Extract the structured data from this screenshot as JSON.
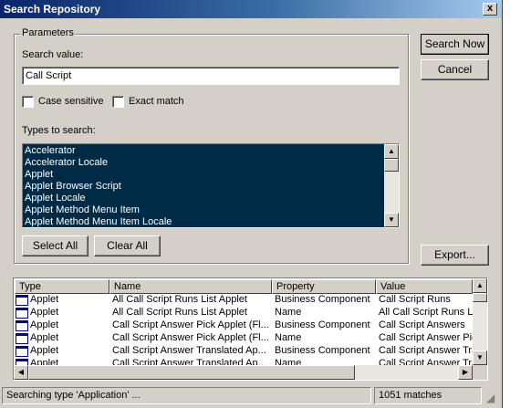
{
  "window": {
    "title": "Search Repository",
    "close_glyph": "x"
  },
  "buttons": {
    "search_now": "Search Now",
    "cancel": "Cancel",
    "export": "Export...",
    "select_all": "Select All",
    "clear_all": "Clear All"
  },
  "parameters": {
    "group_label": "Parameters",
    "search_value_label": "Search value:",
    "search_value": "Call Script",
    "case_sensitive_label": "Case sensitive",
    "case_sensitive_checked": false,
    "exact_match_label": "Exact match",
    "exact_match_checked": false,
    "types_label": "Types to search:",
    "types": [
      "Accelerator",
      "Accelerator Locale",
      "Applet",
      "Applet Browser Script",
      "Applet Locale",
      "Applet Method Menu Item",
      "Applet Method Menu Item Locale"
    ]
  },
  "results": {
    "columns": [
      "Type",
      "Name",
      "Property",
      "Value"
    ],
    "rows": [
      [
        "Applet",
        "All Call Script Runs List Applet",
        "Business Component",
        "Call Script Runs"
      ],
      [
        "Applet",
        "All Call Script Runs List Applet",
        "Name",
        "All Call Script Runs Lis"
      ],
      [
        "Applet",
        "Call Script Answer Pick Applet (Fl...",
        "Business Component",
        "Call Script Answers"
      ],
      [
        "Applet",
        "Call Script Answer Pick Applet (Fl...",
        "Name",
        "Call Script Answer Pic"
      ],
      [
        "Applet",
        "Call Script Answer Translated Ap...",
        "Business Component",
        "Call Script Answer Tra"
      ],
      [
        "Applet",
        "Call Script Answer Translated Ap...",
        "Name",
        "Call Script Answer Tra"
      ]
    ],
    "row_icon": "object-folder-icon"
  },
  "status": {
    "message": "Searching type 'Application' ...",
    "matches": "1051 matches"
  },
  "colors": {
    "title_start": "#0a246a",
    "title_end": "#a6caf0",
    "face": "#d4d0c8",
    "list_selected": "#002b46"
  }
}
